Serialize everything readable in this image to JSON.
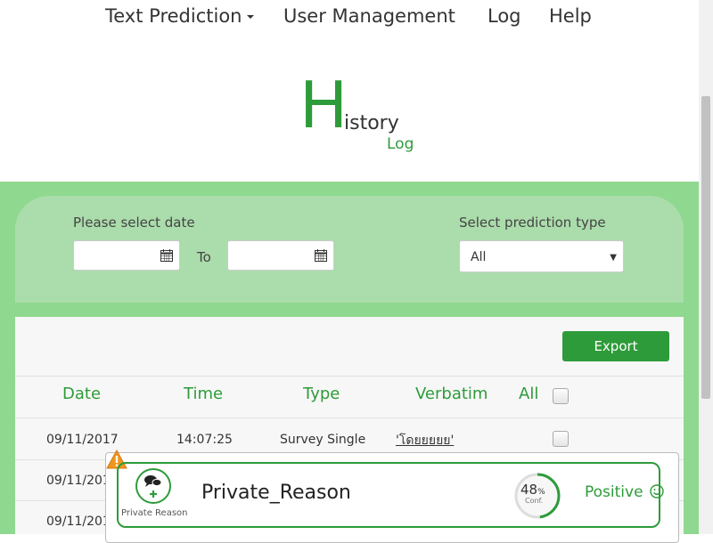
{
  "nav": {
    "items": [
      {
        "label": "Text Prediction",
        "has_dropdown": true
      },
      {
        "label": "User Management"
      },
      {
        "label": "Log"
      },
      {
        "label": "Help"
      }
    ]
  },
  "title": {
    "big": "H",
    "rest": "istory",
    "sub": "Log"
  },
  "filters": {
    "date_label": "Please select date",
    "to_label": "To",
    "from_value": "",
    "to_value": "",
    "type_label": "Select prediction type",
    "type_value": "All"
  },
  "export_label": "Export",
  "table": {
    "headers": {
      "date": "Date",
      "time": "Time",
      "type": "Type",
      "verbatim": "Verbatim",
      "all": "All"
    },
    "rows": [
      {
        "date": "09/11/2017",
        "time": "14:07:25",
        "type": "Survey Single",
        "verbatim": "'โดยยยยย'"
      },
      {
        "date": "09/11/2017",
        "time": "",
        "type": "",
        "verbatim": ""
      },
      {
        "date": "09/11/2017",
        "time": "",
        "type": "",
        "verbatim": ""
      }
    ]
  },
  "popup": {
    "reason_small": "Private Reason",
    "title": "Private_Reason",
    "confidence_pct": "48",
    "percent_sign": "%",
    "confidence_label": "Conf.",
    "confidence_fraction": 0.48,
    "sentiment": "Positive",
    "sentiment_icon": "smiley-icon"
  },
  "colors": {
    "accent": "#2e9b3a",
    "band": "#8fd88f",
    "panel": "#abdcab",
    "warning": "#f0961e"
  }
}
